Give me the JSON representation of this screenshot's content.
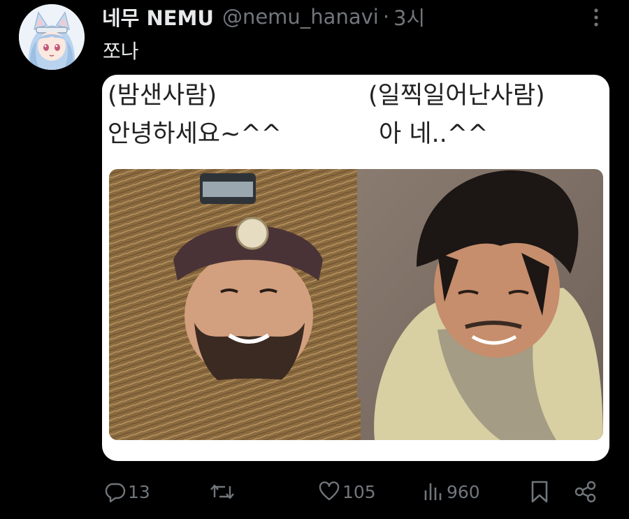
{
  "tweet": {
    "display_name": "네무 NEMU",
    "handle": "@nemu_hanavi",
    "separator": "·",
    "time": "3시",
    "text": "쪼나"
  },
  "image_captions": {
    "left_label": "(밤샌사람)",
    "left_line": "안녕하세요~^^",
    "right_label": "(일찍일어난사람)",
    "right_line": "아 네..^^"
  },
  "actions": {
    "replies": "13",
    "retweets": "",
    "likes": "105",
    "views": "960"
  },
  "icons": {
    "more": "more-vertical-icon",
    "reply": "reply-icon",
    "retweet": "retweet-icon",
    "like": "heart-icon",
    "views": "views-icon",
    "bookmark": "bookmark-icon",
    "share": "share-icon"
  },
  "colors": {
    "background": "#000000",
    "text_primary": "#e7e9ea",
    "text_secondary": "#71767b",
    "card_background": "#ffffff"
  }
}
